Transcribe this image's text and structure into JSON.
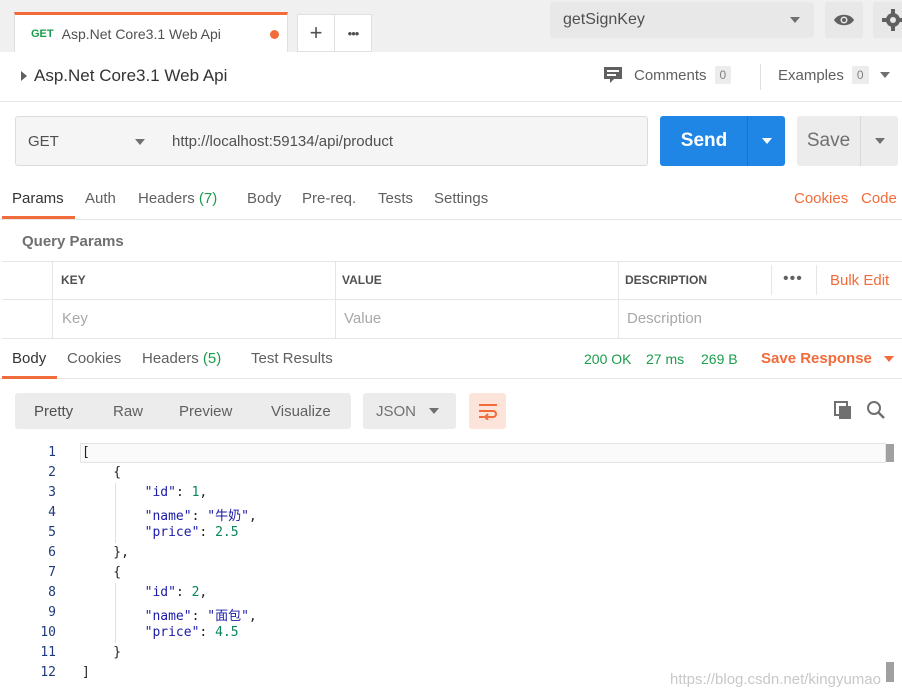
{
  "top_tab": {
    "method": "GET",
    "title": "Asp.Net Core3.1 Web Api"
  },
  "tab_actions": {
    "add": "+",
    "more": "•••"
  },
  "environment": {
    "selected": "getSignKey"
  },
  "breadcrumb": {
    "title": "Asp.Net Core3.1 Web Api"
  },
  "comments": {
    "label": "Comments",
    "count": "0"
  },
  "examples": {
    "label": "Examples",
    "count": "0"
  },
  "request": {
    "method": "GET",
    "url": "http://localhost:59134/api/product"
  },
  "buttons": {
    "send": "Send",
    "save": "Save"
  },
  "request_tabs": {
    "params": "Params",
    "auth": "Auth",
    "headers": "Headers",
    "headers_count": "(7)",
    "body": "Body",
    "prereq": "Pre-req.",
    "tests": "Tests",
    "settings": "Settings",
    "cookies": "Cookies",
    "code": "Code"
  },
  "query_params": {
    "label": "Query Params",
    "headers": [
      "KEY",
      "VALUE",
      "DESCRIPTION"
    ],
    "placeholders": [
      "Key",
      "Value",
      "Description"
    ],
    "more": "•••",
    "bulk_edit": "Bulk Edit"
  },
  "response_tabs": {
    "body": "Body",
    "cookies": "Cookies",
    "headers": "Headers",
    "headers_count": "(5)",
    "test_results": "Test Results"
  },
  "response_status": {
    "status": "200 OK",
    "time": "27 ms",
    "size": "269 B",
    "save": "Save Response"
  },
  "view_modes": [
    "Pretty",
    "Raw",
    "Preview",
    "Visualize"
  ],
  "format": {
    "selected": "JSON"
  },
  "code_lines": [
    "[",
    "    {",
    "        \"id\": 1,",
    "        \"name\": \"牛奶\",",
    "        \"price\": 2.5",
    "    },",
    "    {",
    "        \"id\": 2,",
    "        \"name\": \"面包\",",
    "        \"price\": 4.5",
    "    }",
    "]"
  ],
  "line_numbers": [
    "1",
    "2",
    "3",
    "4",
    "5",
    "6",
    "7",
    "8",
    "9",
    "10",
    "11",
    "12"
  ],
  "watermark": "https://blog.csdn.net/kingyumao",
  "colors": {
    "accent": "#f26b3a",
    "send": "#1f86e6",
    "success": "#1c9c4c"
  }
}
